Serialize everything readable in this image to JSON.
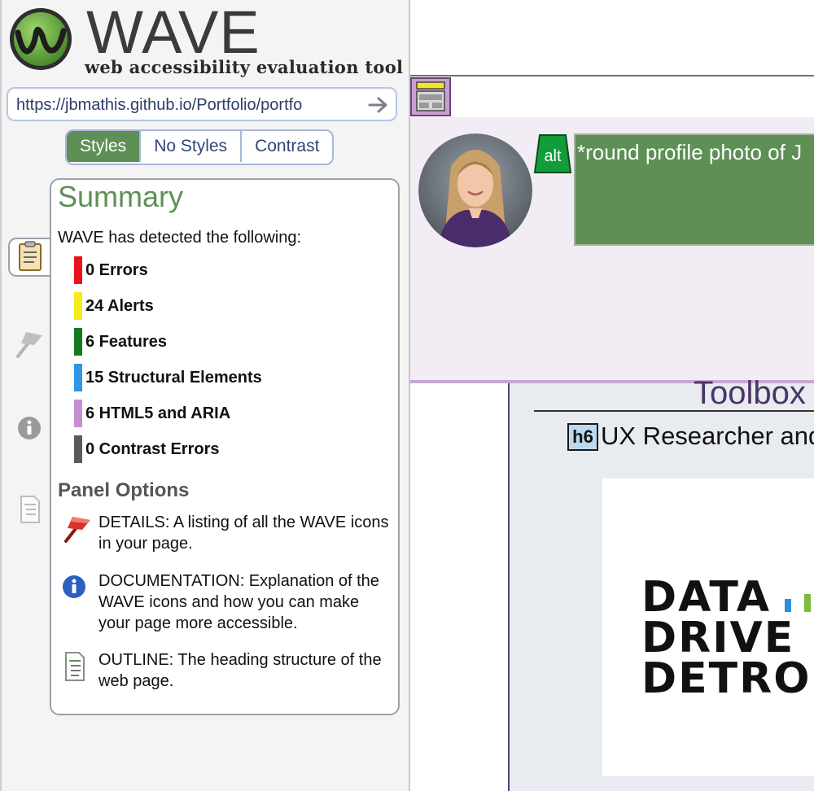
{
  "app": {
    "logo_text": "WAVE",
    "tagline": "web accessibility evaluation tool"
  },
  "url_bar": {
    "value": "https://jbmathis.github.io/Portfolio/portfo"
  },
  "view_tabs": [
    {
      "label": "Styles",
      "active": true
    },
    {
      "label": "No Styles",
      "active": false
    },
    {
      "label": "Contrast",
      "active": false
    }
  ],
  "summary": {
    "title": "Summary",
    "intro": "WAVE has detected the following:",
    "stats": [
      {
        "label": "0 Errors",
        "color": "#e8141b"
      },
      {
        "label": "24 Alerts",
        "color": "#f5ea1c"
      },
      {
        "label": "6 Features",
        "color": "#137a1f"
      },
      {
        "label": "15 Structural Elements",
        "color": "#3195e6"
      },
      {
        "label": "6 HTML5 and ARIA",
        "color": "#c48fd0"
      },
      {
        "label": "0 Contrast Errors",
        "color": "#5a5a5a"
      }
    ],
    "panel_options_title": "Panel Options",
    "options": [
      {
        "icon": "flag-icon",
        "text": "DETAILS: A listing of all the WAVE icons in your page."
      },
      {
        "icon": "info-icon",
        "text": "DOCUMENTATION: Explanation of the WAVE icons and how you can make your page more accessible."
      },
      {
        "icon": "outline-icon",
        "text": "OUTLINE: The heading structure of the web page."
      }
    ]
  },
  "side_tabs": [
    "clipboard-icon",
    "flag-icon",
    "info-icon",
    "outline-icon"
  ],
  "preview": {
    "alt_badge": "alt",
    "alt_text": "*round profile photo of J",
    "heading": "Toolbox",
    "h6_badge": "h6",
    "subheading": "UX Researcher and",
    "logo_lines": [
      "DATA",
      "DRIVE",
      "DETRO"
    ]
  },
  "colors": {
    "brand_green": "#5e8f55",
    "tab_border": "#a7b6dd",
    "hero_bg": "#f2ecf4",
    "accent_purple": "#5a3f73"
  }
}
